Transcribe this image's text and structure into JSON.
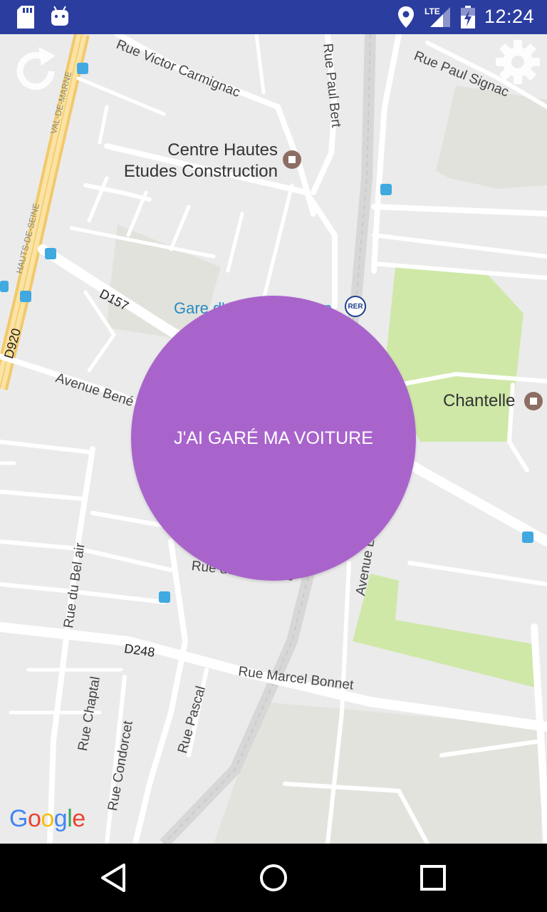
{
  "status_bar": {
    "time": "12:24",
    "network": "LTE",
    "icons": [
      "sd-card-icon",
      "android-icon",
      "location-icon",
      "signal-icon",
      "battery-icon"
    ],
    "background": "#2c3da0"
  },
  "map": {
    "streets": {
      "rue_victor_carmignac": "Rue Victor Carmignac",
      "rue_paul_bert": "Rue Paul Bert",
      "rue_paul_signac": "Rue Paul Signac",
      "avenue_bene": "Avenue Bené",
      "rue_du_bel_air": "Rue du Bel air",
      "rue_de_la_liberte": "Rue de la Liberté",
      "avenue_leo": "Avenue Léo",
      "rue_marcel_bonnet": "Rue Marcel Bonnet",
      "rue_chaptal": "Rue Chaptal",
      "rue_condorcet": "Rue Condorcet",
      "rue_pascal": "Rue Pascal",
      "val_de_marne": "VAL-DE-MARNE",
      "hauts_de_seine": "HAUTS-DE-SEINE"
    },
    "road_numbers": {
      "d157": "D157",
      "d920": "D920",
      "d248": "D248"
    },
    "pois": {
      "centre_line1": "Centre Hautes",
      "centre_line2": "Etudes Construction",
      "chantelle": "Chantelle",
      "gare": "Gare d'Arcueil-Cachan",
      "rer": "RER"
    },
    "colors": {
      "land": "#ebebeb",
      "road": "#ffffff",
      "highway": "#f7d98a",
      "park": "#cfe8a8",
      "station_text": "#2a8bc2",
      "poi_marker": "#8d6e63"
    }
  },
  "controls": {
    "refresh_icon": "refresh-icon",
    "settings_icon": "gear-icon"
  },
  "park_button": {
    "label": "J'AI GARÉ MA VOITURE",
    "color": "#a964cc"
  },
  "google_logo": {
    "letters": [
      "G",
      "o",
      "o",
      "g",
      "l",
      "e"
    ],
    "colors": [
      "#4285f4",
      "#ea4335",
      "#fbbc05",
      "#4285f4",
      "#34a853",
      "#ea4335"
    ]
  },
  "nav_bar": {
    "icons": [
      "back-icon",
      "home-icon",
      "recents-icon"
    ]
  }
}
